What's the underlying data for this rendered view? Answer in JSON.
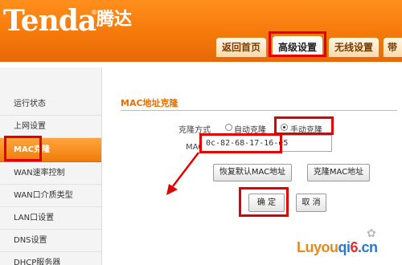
{
  "brand": {
    "logo": "Tenda",
    "registered": "®",
    "name_cn": "腾达"
  },
  "tabs": [
    {
      "label": "返回首页",
      "active": false
    },
    {
      "label": "高级设置",
      "active": true
    },
    {
      "label": "无线设置",
      "active": false
    },
    {
      "label": "带宽",
      "active": false
    }
  ],
  "sidebar": {
    "items": [
      {
        "label": "运行状态",
        "active": false
      },
      {
        "label": "上网设置",
        "active": false
      },
      {
        "label": "MAC克隆",
        "active": true
      },
      {
        "label": "WAN速率控制",
        "active": false
      },
      {
        "label": "WAN口介质类型",
        "active": false
      },
      {
        "label": "LAN口设置",
        "active": false
      },
      {
        "label": "DNS设置",
        "active": false
      },
      {
        "label": "DHCP服务器",
        "active": false
      }
    ]
  },
  "main": {
    "section_title": "MAC地址克隆",
    "clone_mode": {
      "label": "克隆方式",
      "options": [
        {
          "label": "自动克隆",
          "selected": false
        },
        {
          "label": "手动克隆",
          "selected": true
        }
      ]
    },
    "mac_field": {
      "label": "MAC地址",
      "value": "0c-82-68-17-16-e5"
    },
    "buttons": {
      "restore_default": "恢复默认MAC地址",
      "clone_mac": "克隆MAC地址",
      "ok": "确 定",
      "cancel": "取 消"
    }
  },
  "watermark": {
    "text_part1": "Luyou",
    "text_part2": "qi",
    "text_part3": "6",
    "text_part4": ".cn"
  },
  "colors": {
    "accent": "#f5790a",
    "highlight": "#e10000",
    "section_title": "#e86f00"
  }
}
